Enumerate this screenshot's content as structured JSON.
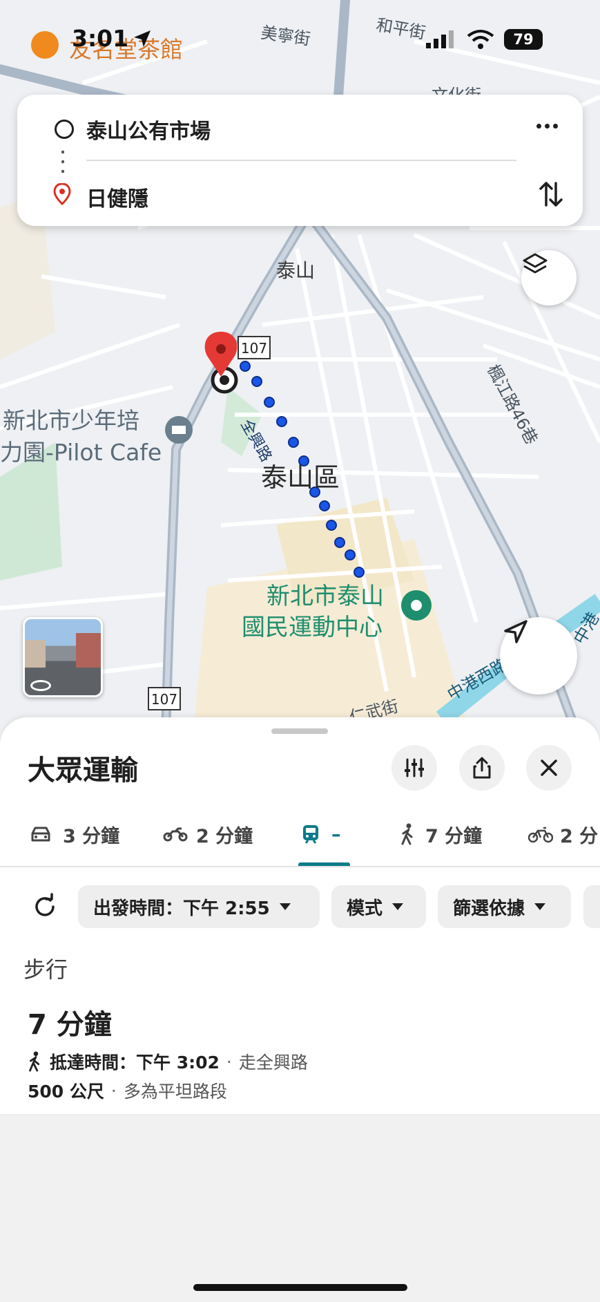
{
  "status_bar": {
    "time": "3:01",
    "battery": "79"
  },
  "map": {
    "poi_top": "友名堂茶館",
    "streets": [
      "美寧街",
      "和平街",
      "文化街",
      "楓江路46巷",
      "全興路",
      "中港西路",
      "中港",
      "仁武街"
    ],
    "district": "泰山區",
    "place_taishan": "泰山",
    "poi_left_line1": "新北市少年培",
    "poi_left_line2": "力園-Pilot Cafe",
    "poi_sports_line1": "新北市泰山",
    "poi_sports_line2": "國民運動中心",
    "route_shield_top": "107",
    "route_shield_bottom": "107"
  },
  "directions": {
    "origin": "泰山公有市場",
    "destination": "日健隱"
  },
  "sheet": {
    "title": "大眾運輸",
    "modes": [
      {
        "icon": "car-icon",
        "label": "3 分鐘"
      },
      {
        "icon": "motorcycle-icon",
        "label": "2 分鐘"
      },
      {
        "icon": "transit-icon",
        "label": "–"
      },
      {
        "icon": "walk-icon",
        "label": "7 分鐘"
      },
      {
        "icon": "bike-icon",
        "label": "2 分"
      }
    ],
    "selected_mode": "transit",
    "chips": {
      "depart": "出發時間：下午 2:55",
      "mode": "模式",
      "filter": "篩選依據"
    },
    "section_title": "步行",
    "result": {
      "duration": "7 分鐘",
      "arrival": "抵達時間：下午 3:02",
      "via": "走全興路",
      "distance": "500 公尺",
      "terrain": "多為平坦路段"
    }
  },
  "colors": {
    "accent": "#0b7a8a",
    "route_dot": "#1a56e8",
    "pin": "#e53935",
    "sports_green": "#1e8e6e"
  }
}
